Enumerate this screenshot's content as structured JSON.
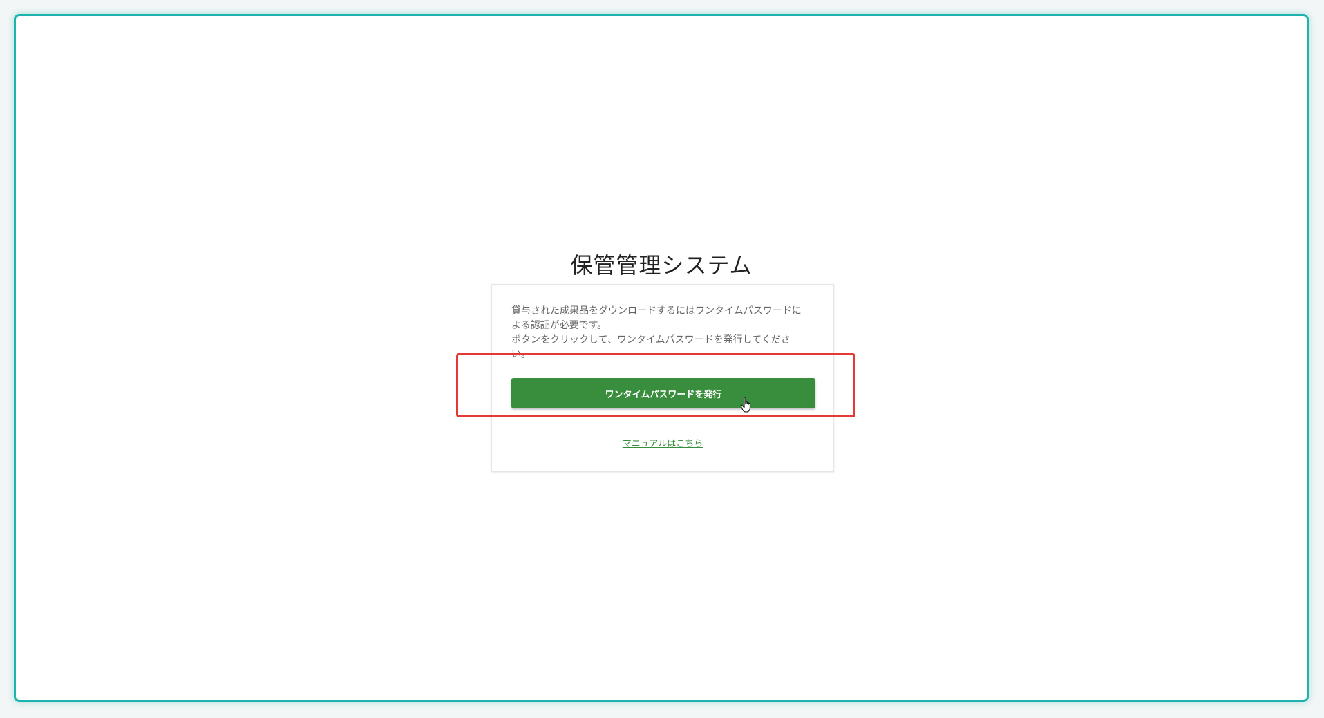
{
  "page": {
    "title": "保管管理システム"
  },
  "card": {
    "message": "貸与された成果品をダウンロードするにはワンタイムパスワードに\nよる認証が必要です。\nボタンをクリックして、ワンタイムパスワードを発行してくださ\nい。",
    "issue_button_label": "ワンタイムパスワードを発行",
    "manual_link_label": "マニュアルはこちら"
  },
  "colors": {
    "primary_green": "#388e3c",
    "frame_teal": "#1fb3ad",
    "highlight_red": "#e53935"
  },
  "icons": {
    "cursor": "hand-pointer-icon"
  }
}
